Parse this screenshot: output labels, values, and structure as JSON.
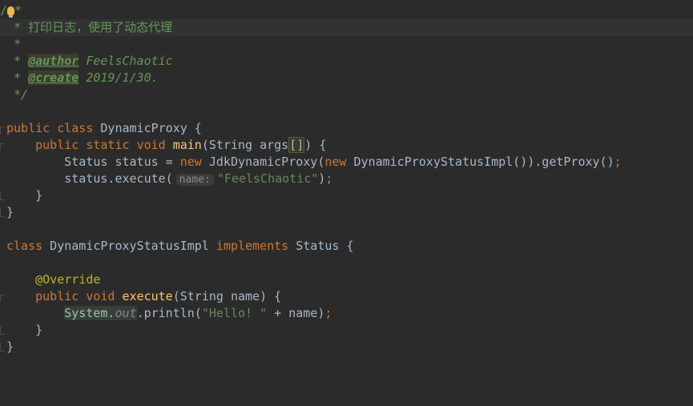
{
  "editor": {
    "lines": {
      "l1": {
        "slash": "/",
        "star": "*"
      },
      "l2": {
        "star": " * ",
        "text": "打印日志，使用了动态代理"
      },
      "l3": {
        "star": " *"
      },
      "l4": {
        "star": " * ",
        "tag": "@author",
        "value": " FeelsChaotic"
      },
      "l5": {
        "star": " * ",
        "tag": "@create",
        "value": " 2019/1/30."
      },
      "l6": {
        "end": " */"
      },
      "l8": {
        "kw1": "public",
        "kw2": "class",
        "name": " DynamicProxy {"
      },
      "l9": {
        "indent": "    ",
        "kw1": "public",
        "kw2": "static",
        "kw3": "void",
        "method": "main",
        "params_a": "(String args",
        "brackets": "[]",
        "params_b": ") {"
      },
      "l10": {
        "indent": "        ",
        "text_a": "Status status = ",
        "kw": "new",
        "text_b": " JdkDynamicProxy(",
        "kw2": "new",
        "text_c": " DynamicProxyStatusImpl()).getProxy()",
        "semi": ";"
      },
      "l11": {
        "indent": "        ",
        "text_a": "status.execute(",
        "hint": "name:",
        "str": "\"FeelsChaotic\"",
        "text_b": ")",
        "semi": ";"
      },
      "l12": {
        "text": "    }"
      },
      "l13": {
        "text": "}"
      },
      "l15": {
        "kw1": "class",
        "name": " DynamicProxyStatusImpl ",
        "kw2": "implements",
        "rest": " Status {"
      },
      "l17": {
        "indent": "    ",
        "ann": "@Override"
      },
      "l18": {
        "indent": "    ",
        "kw1": "public",
        "kw2": "void",
        "method": "execute",
        "params": "(String name) {"
      },
      "l19": {
        "indent": "        ",
        "sys": "System.",
        "field": "out",
        "text_a": ".println(",
        "str": "\"Hello! \"",
        "text_b": " + name)",
        "semi": ";"
      },
      "l20": {
        "text": "    }"
      },
      "l21": {
        "text": "}"
      }
    },
    "colors": {
      "background": "#2b2b2b",
      "keyword": "#cc7832",
      "method": "#ffc66d",
      "string": "#6a8759",
      "doc_comment": "#629755",
      "annotation": "#bbb529",
      "field": "#9876aa",
      "plain": "#a9b7c6"
    },
    "icons": {
      "intention": "lightbulb-icon"
    }
  }
}
